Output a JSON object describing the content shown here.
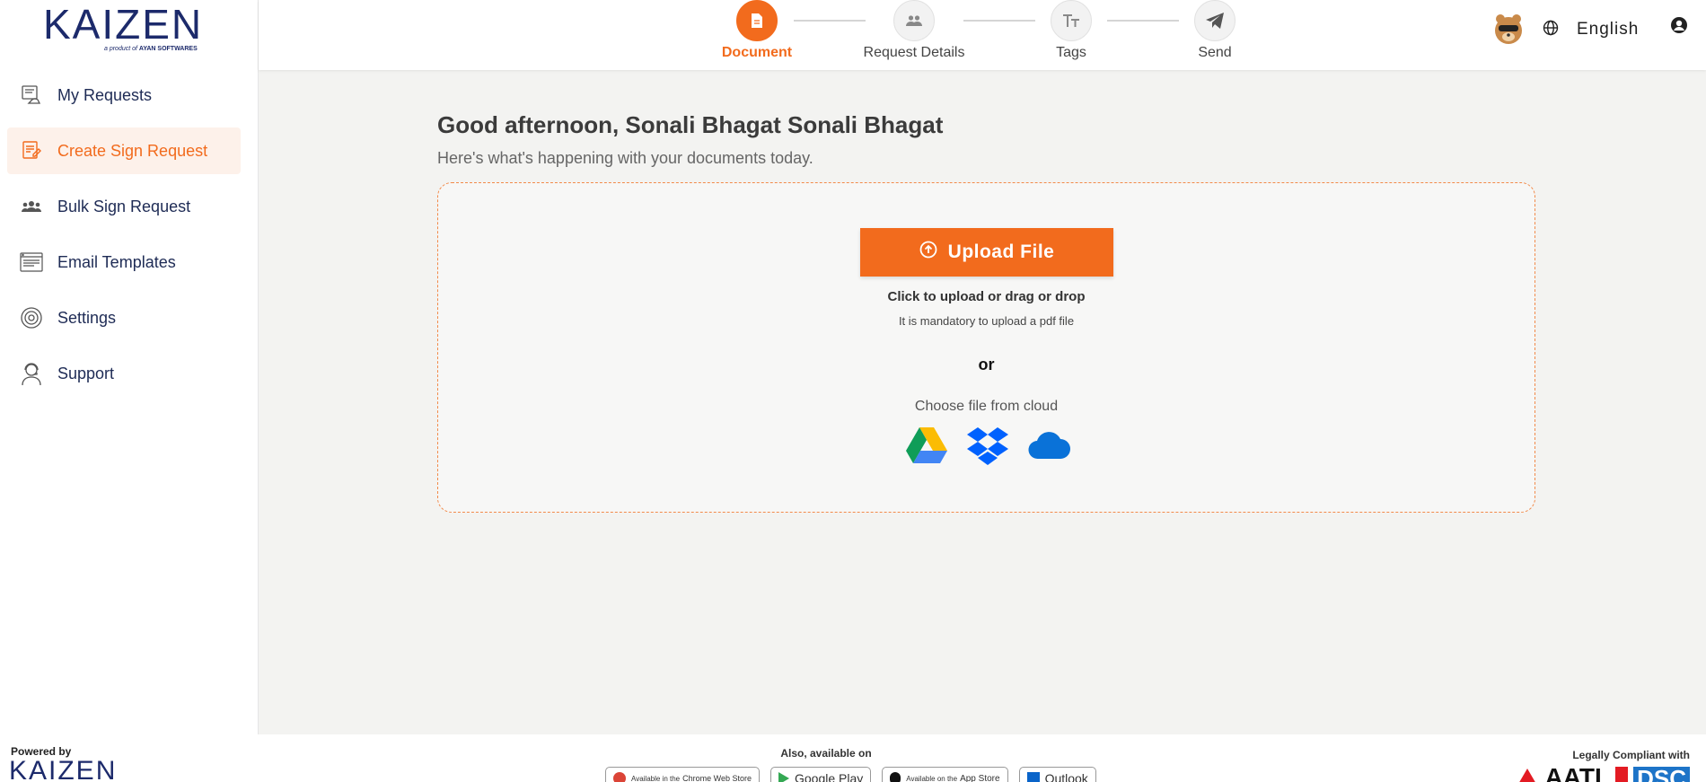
{
  "brand": {
    "logo_text": "KAIZEN",
    "logo_tagline_prefix": "a product of",
    "logo_tagline_company": "AYAN SOFTWARES"
  },
  "sidebar": {
    "items": [
      {
        "label": "My Requests",
        "icon": "requests-icon",
        "active": false
      },
      {
        "label": "Create Sign Request",
        "icon": "create-sign-icon",
        "active": true
      },
      {
        "label": "Bulk Sign Request",
        "icon": "group-icon",
        "active": false
      },
      {
        "label": "Email Templates",
        "icon": "email-template-icon",
        "active": false
      },
      {
        "label": "Settings",
        "icon": "gear-icon",
        "active": false
      },
      {
        "label": "Support",
        "icon": "support-agent-icon",
        "active": false
      }
    ]
  },
  "stepper": {
    "steps": [
      {
        "label": "Document",
        "icon": "document-icon",
        "active": true
      },
      {
        "label": "Request Details",
        "icon": "people-icon",
        "active": false
      },
      {
        "label": "Tags",
        "icon": "text-size-icon",
        "active": false
      },
      {
        "label": "Send",
        "icon": "send-icon",
        "active": false
      }
    ]
  },
  "header": {
    "language": "English",
    "avatar_icon": "avatar-icon",
    "globe_icon": "globe-icon",
    "user_icon": "user-icon"
  },
  "main": {
    "greeting": "Good afternoon, Sonali Bhagat Sonali Bhagat",
    "subtitle": "Here's what's happening with your documents today.",
    "upload_button": "Upload File",
    "upload_title": "Click to upload or drag or drop",
    "upload_note": "It is mandatory to upload a pdf file",
    "or_text": "or",
    "cloud_text": "Choose file from cloud",
    "cloud_providers": [
      "google-drive-icon",
      "dropbox-icon",
      "onedrive-icon"
    ]
  },
  "footer": {
    "powered_by": "Powered by",
    "also_available": "Also, available on",
    "badges": [
      {
        "small": "Available in the",
        "label": "Chrome Web Store"
      },
      {
        "small": "",
        "label": "Google Play"
      },
      {
        "small": "Available on the",
        "label": "App Store"
      },
      {
        "small": "",
        "label": "Outlook"
      }
    ],
    "legally_compliant": "Legally Compliant with",
    "compliance_1": "AATL",
    "compliance_2": "DSC"
  },
  "colors": {
    "accent": "#f26b1d",
    "navy": "#1e2b55",
    "background": "#f3f3f1"
  }
}
